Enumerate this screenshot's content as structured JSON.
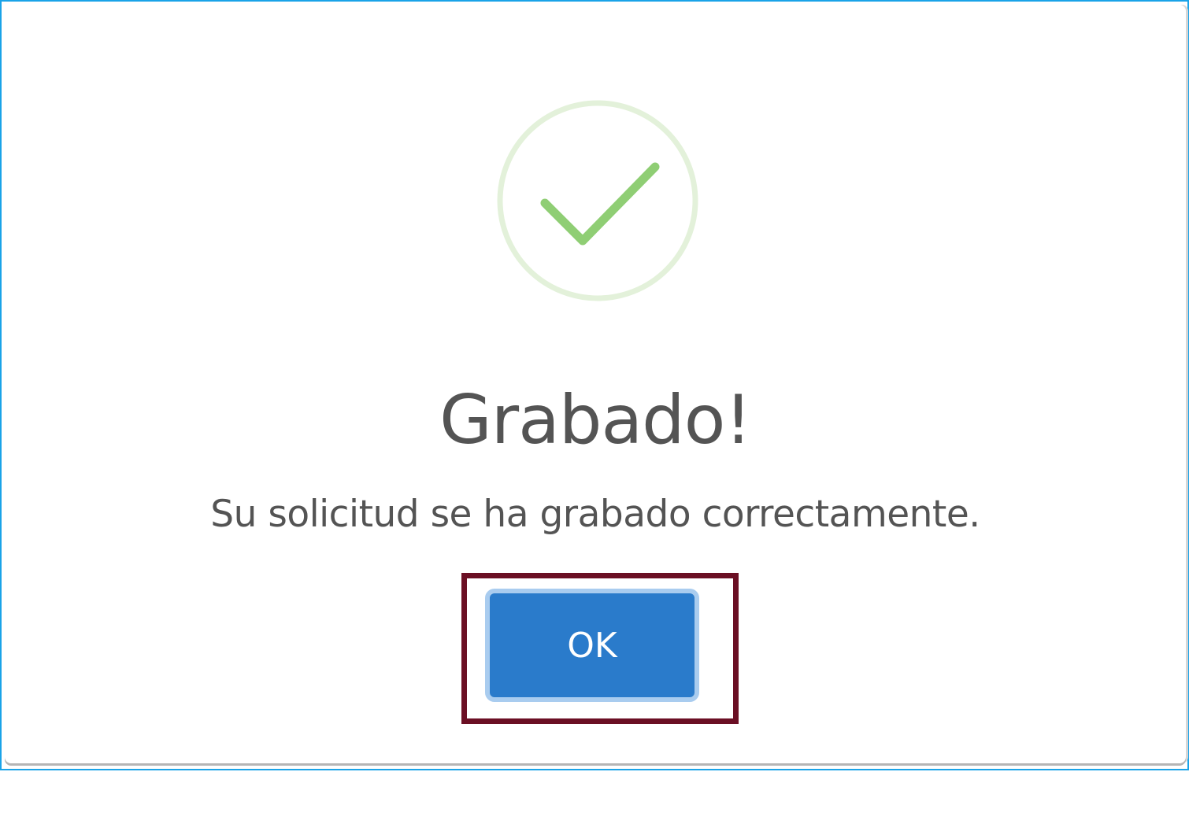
{
  "dialog": {
    "icon": "success-checkmark-icon",
    "title": "Grabado!",
    "message": "Su solicitud se ha grabado correctamente.",
    "confirm_label": "OK"
  },
  "colors": {
    "frame_border": "#1aa3e8",
    "check_stroke": "#8fce74",
    "circle_ring": "#e3f1da",
    "text": "#545454",
    "button_bg": "#2a7bcb",
    "button_focus_ring": "#a9ccef",
    "highlight_border": "#6b0f24"
  }
}
